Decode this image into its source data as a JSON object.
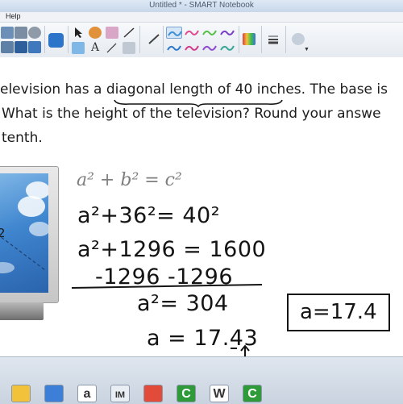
{
  "window": {
    "title": "Untitled * - SMART Notebook"
  },
  "menu": {
    "help_label": "Help"
  },
  "toolbar": {
    "icons": [
      "undo-icon",
      "redo-icon",
      "delete-icon",
      "screen-shade-icon",
      "page-sorter-icon",
      "table-icon",
      "move-icon",
      "select-icon",
      "pen-icon",
      "eraser-icon",
      "lines-icon",
      "shapes-icon",
      "text-icon",
      "fill-icon",
      "properties-icon"
    ],
    "pen_colors": [
      "#3f8fd4",
      "#e04b8f",
      "#5abf4a",
      "#7a3fc9",
      "#2c7ac9",
      "#d23a8a",
      "#8e4bd0",
      "#3aa69a"
    ]
  },
  "question": {
    "line1": "elevision has a diagonal length of 40 inches.  The base is",
    "line2": "What is the height of the television?  Round your answe",
    "line3": "tenth."
  },
  "figure": {
    "label": "2"
  },
  "work": {
    "formula": "a² + b² = c²",
    "step1": "a²+36²= 40²",
    "step2": "a²+1296 = 1600",
    "step3": "-1296  -1296",
    "step4": "a²= 304",
    "step5": "a = 17.43"
  },
  "answer": {
    "text": "a=17.4"
  },
  "taskbar": {
    "apps": [
      {
        "name": "windows-explorer-icon",
        "label": "",
        "color": "#f3c23b"
      },
      {
        "name": "smart-notebook-icon",
        "label": "",
        "color": "#3d7ed6"
      },
      {
        "name": "amazon-icon",
        "label": "a",
        "color": "#ffffff"
      },
      {
        "name": "im-icon",
        "label": "IM",
        "color": "#e9eef4"
      },
      {
        "name": "chrome-icon",
        "label": "",
        "color": "#e24a3a"
      },
      {
        "name": "camtasia-icon",
        "label": "C",
        "color": "#2f9a39"
      },
      {
        "name": "wordpress-icon",
        "label": "W",
        "color": "#ffffff"
      },
      {
        "name": "camtasia-recorder-icon",
        "label": "C",
        "color": "#2f9a39"
      }
    ]
  }
}
